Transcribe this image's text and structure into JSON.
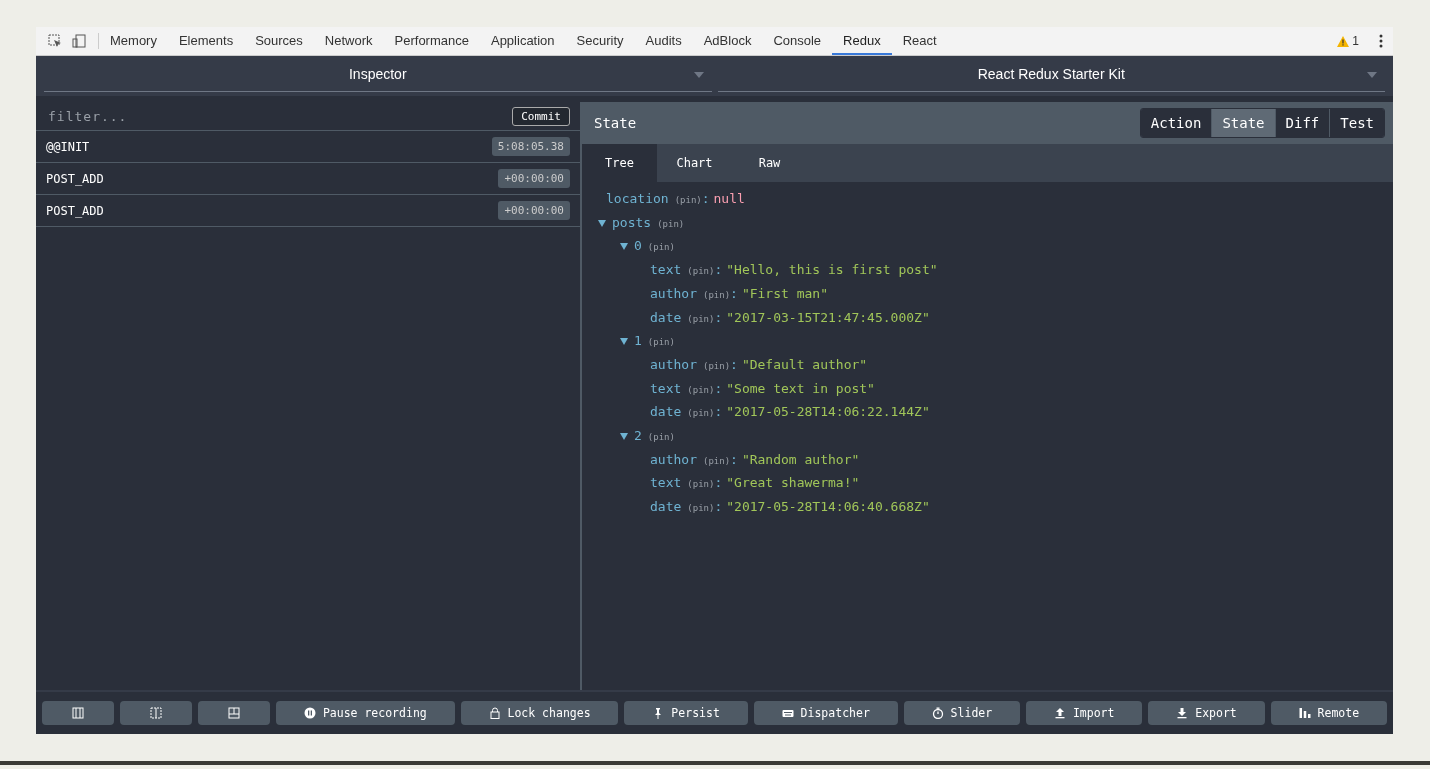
{
  "tabs": [
    {
      "label": "Memory",
      "selected": false
    },
    {
      "label": "Elements",
      "selected": false
    },
    {
      "label": "Sources",
      "selected": false
    },
    {
      "label": "Network",
      "selected": false
    },
    {
      "label": "Performance",
      "selected": false
    },
    {
      "label": "Application",
      "selected": false
    },
    {
      "label": "Security",
      "selected": false
    },
    {
      "label": "Audits",
      "selected": false
    },
    {
      "label": "AdBlock",
      "selected": false
    },
    {
      "label": "Console",
      "selected": false
    },
    {
      "label": "Redux",
      "selected": true
    },
    {
      "label": "React",
      "selected": false
    }
  ],
  "warnings": {
    "count": "1"
  },
  "instance_selectors": [
    {
      "label": "Inspector"
    },
    {
      "label": "React Redux Starter Kit"
    }
  ],
  "filter": {
    "placeholder": "filter..."
  },
  "commit_button": "Commit",
  "actions": [
    {
      "type": "@@INIT",
      "time": "5:08:05.38"
    },
    {
      "type": "POST_ADD",
      "time": "+00:00:00"
    },
    {
      "type": "POST_ADD",
      "time": "+00:00:00"
    }
  ],
  "monitor": {
    "title": "State",
    "modes": [
      {
        "label": "Action",
        "selected": false
      },
      {
        "label": "State",
        "selected": true
      },
      {
        "label": "Diff",
        "selected": false
      },
      {
        "label": "Test",
        "selected": false
      }
    ],
    "subtabs": [
      {
        "label": "Tree",
        "selected": true
      },
      {
        "label": "Chart",
        "selected": false
      },
      {
        "label": "Raw",
        "selected": false
      }
    ],
    "tree": [
      {
        "key": "location",
        "pin": "(pin)",
        "kind": "null",
        "separator": ":",
        "value": "null"
      },
      {
        "key": "posts",
        "pin": "(pin)",
        "kind": "object",
        "expanded": true,
        "children": [
          {
            "key": "0",
            "pin": "(pin)",
            "kind": "object",
            "expanded": true,
            "children": [
              {
                "key": "text",
                "pin": "(pin)",
                "kind": "string",
                "separator": ":",
                "value": "\"Hello, this is first post\""
              },
              {
                "key": "author",
                "pin": "(pin)",
                "kind": "string",
                "separator": ":",
                "value": "\"First man\""
              },
              {
                "key": "date",
                "pin": "(pin)",
                "kind": "string",
                "separator": ":",
                "value": "\"2017-03-15T21:47:45.000Z\""
              }
            ]
          },
          {
            "key": "1",
            "pin": "(pin)",
            "kind": "object",
            "expanded": true,
            "children": [
              {
                "key": "author",
                "pin": "(pin)",
                "kind": "string",
                "separator": ":",
                "value": "\"Default author\""
              },
              {
                "key": "text",
                "pin": "(pin)",
                "kind": "string",
                "separator": ":",
                "value": "\"Some text in post\""
              },
              {
                "key": "date",
                "pin": "(pin)",
                "kind": "string",
                "separator": ":",
                "value": "\"2017-05-28T14:06:22.144Z\""
              }
            ]
          },
          {
            "key": "2",
            "pin": "(pin)",
            "kind": "object",
            "expanded": true,
            "children": [
              {
                "key": "author",
                "pin": "(pin)",
                "kind": "string",
                "separator": ":",
                "value": "\"Random author\""
              },
              {
                "key": "text",
                "pin": "(pin)",
                "kind": "string",
                "separator": ":",
                "value": "\"Great shawerma!\""
              },
              {
                "key": "date",
                "pin": "(pin)",
                "kind": "string",
                "separator": ":",
                "value": "\"2017-05-28T14:06:40.668Z\""
              }
            ]
          }
        ]
      }
    ]
  },
  "toolbar": [
    {
      "kind": "dock-left"
    },
    {
      "kind": "dock-center"
    },
    {
      "kind": "dock-bottom"
    },
    {
      "kind": "pause",
      "label": "Pause recording"
    },
    {
      "kind": "lock",
      "label": "Lock changes"
    },
    {
      "kind": "pin",
      "label": "Persist"
    },
    {
      "kind": "keyboard",
      "label": "Dispatcher"
    },
    {
      "kind": "timer",
      "label": "Slider"
    },
    {
      "kind": "upload",
      "label": "Import"
    },
    {
      "kind": "download",
      "label": "Export"
    },
    {
      "kind": "remote",
      "label": "Remote"
    }
  ]
}
